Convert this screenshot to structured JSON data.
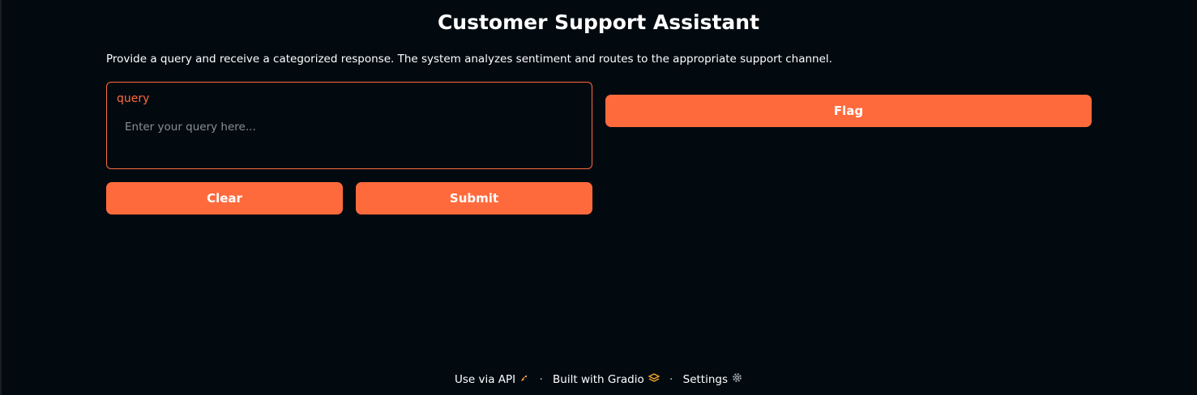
{
  "app": {
    "title": "Customer Support Assistant",
    "description": "Provide a query and receive a categorized response. The system analyzes sentiment and routes to the appropriate support channel."
  },
  "query": {
    "label": "query",
    "value": "",
    "placeholder": "Enter your query here..."
  },
  "buttons": {
    "clear_label": "Clear",
    "submit_label": "Submit",
    "flag_label": "Flag"
  },
  "footer": {
    "api_label": "Use via API",
    "api_icon": "rocket-icon",
    "separator": "·",
    "built_with_label": "Built with Gradio",
    "built_with_icon": "gradio-logo-icon",
    "settings_label": "Settings",
    "settings_icon": "gear-icon"
  },
  "colors": {
    "background": "#020a10",
    "accent": "#ff6a3d",
    "text": "#ffffff",
    "placeholder": "#8a8f96"
  }
}
